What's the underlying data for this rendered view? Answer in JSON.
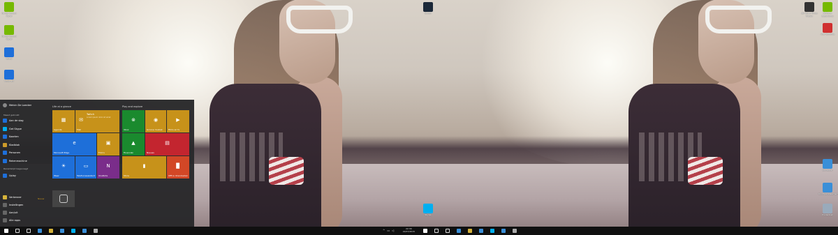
{
  "left_desktop_icons": [
    {
      "label": "Nvidia Control Panel",
      "icon": "nvidia-icon",
      "color": "#76b900"
    },
    {
      "label": "Nvidia Control Panel",
      "icon": "nvidia-icon",
      "color": "#76b900"
    },
    {
      "label": "Uplay",
      "icon": "uplay-icon",
      "color": "#1e6fd9"
    },
    {
      "label": "Uplay 2D",
      "icon": "uplay-icon",
      "color": "#1e6fd9"
    }
  ],
  "right_desktop_icons": [
    {
      "label": "Steam",
      "icon": "steam-icon",
      "color": "#1b2838"
    },
    {
      "label": "3D Vision Photo Viewer",
      "icon": "3d-vision-icon",
      "color": "#333333"
    },
    {
      "label": "GeForce Experience",
      "icon": "geforce-icon",
      "color": "#76b900"
    },
    {
      "label": "Acer Controls",
      "icon": "app-icon",
      "color": "#d03030"
    },
    {
      "label": "Computer",
      "icon": "computer-icon",
      "color": "#3a8fd8"
    },
    {
      "label": "Configuratiescherm",
      "icon": "control-panel-icon",
      "color": "#3a8fd8"
    },
    {
      "label": "Prullenbak",
      "icon": "recycle-bin-icon",
      "color": "#9ab"
    },
    {
      "label": "Skype",
      "icon": "skype-icon",
      "color": "#00aff0"
    }
  ],
  "start_menu": {
    "user": "Melvin De Loecker",
    "most_used_header": "Meest gebruikt",
    "most_used": [
      {
        "label": "Aan de slag",
        "icon": "lightbulb-icon",
        "color": "#1e6fd9"
      },
      {
        "label": "Get Skype",
        "icon": "skype-icon",
        "color": "#00aff0"
      },
      {
        "label": "Kaarten",
        "icon": "maps-icon",
        "color": "#1e6fd9"
      },
      {
        "label": "Kladblok",
        "icon": "notepad-icon",
        "color": "#cc9a2a"
      },
      {
        "label": "Personen",
        "icon": "people-icon",
        "color": "#1e6fd9"
      },
      {
        "label": "Rekenmachine",
        "icon": "calculator-icon",
        "color": "#1e6fd9"
      }
    ],
    "recent_header": "Recentelijk toegevoegd",
    "recent": [
      {
        "label": "Uplay",
        "icon": "uplay-icon",
        "color": "#1e6fd9"
      }
    ],
    "bottom": [
      {
        "label": "Verkenner",
        "icon": "explorer-icon",
        "color": "#d6b33a"
      },
      {
        "label": "Instellingen",
        "icon": "gear-icon",
        "color": "#666666"
      },
      {
        "label": "Aan/uit",
        "icon": "power-icon",
        "color": "#666666"
      },
      {
        "label": "Alle apps",
        "icon": "list-icon",
        "color": "#666666"
      }
    ],
    "new_badge": "Nieuw",
    "group_life": "Life at a glance",
    "group_play": "Play and explore",
    "tiles_life": [
      {
        "label": "Agenda",
        "color": "#c7921a",
        "glyph": "▦"
      },
      {
        "label": "Mail",
        "color": "#c7921a",
        "glyph": "✉"
      },
      {
        "label": "Microsoft Edge",
        "color": "#1e6fd9",
        "glyph": "e"
      },
      {
        "label": "Foto's",
        "color": "#c7921a",
        "glyph": "▣"
      },
      {
        "label": "Weer",
        "color": "#1e6fd9",
        "glyph": "☀"
      },
      {
        "label": "Telefoonassistent",
        "color": "#1e6fd9",
        "glyph": "▭"
      },
      {
        "label": "OneNote",
        "color": "#7a2d8a",
        "glyph": "N"
      }
    ],
    "mail_tile_title": "Twitch",
    "mail_tile_sub": "Lorem ipsum dolor sit amet",
    "tiles_play": [
      {
        "label": "Xbox",
        "color": "#1a8a2e",
        "glyph": "⊗"
      },
      {
        "label": "Groove muziek",
        "color": "#c7921a",
        "glyph": "◉"
      },
      {
        "label": "Films en tv",
        "color": "#c7921a",
        "glyph": "▶"
      },
      {
        "label": "Financiën",
        "color": "#1a8a2e",
        "glyph": "▲"
      },
      {
        "label": "Nieuws",
        "color": "#c3252f",
        "glyph": "▤"
      },
      {
        "label": "Store",
        "color": "#c7921a",
        "glyph": "▮"
      },
      {
        "label": "Office downloaden",
        "color": "#d24726",
        "glyph": "▉"
      }
    ],
    "extra_tile_icon": "steam-icon"
  },
  "taskbar": {
    "left_items": [
      "windows-icon",
      "search-icon",
      "task-view-icon",
      "edge-icon",
      "explorer-icon",
      "store-icon",
      "skype-icon",
      "mail-icon",
      "steam-icon"
    ],
    "time": "22:30",
    "date": "22/07/2015"
  }
}
